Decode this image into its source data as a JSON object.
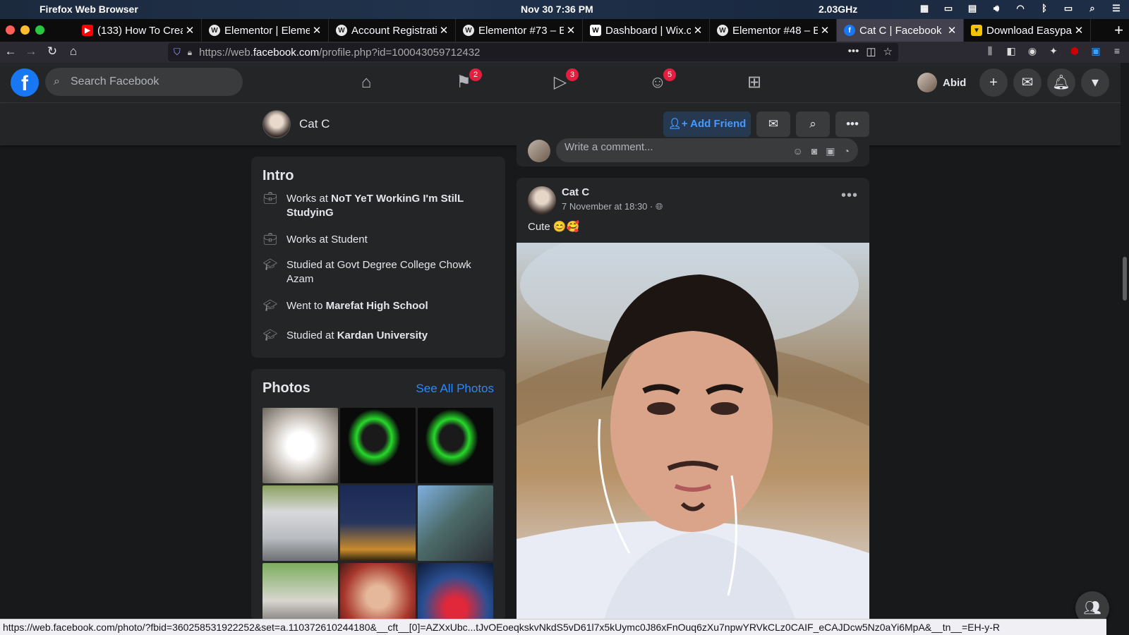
{
  "menubar": {
    "app_name": "Firefox Web Browser",
    "datetime": "Nov 30   7:36 PM",
    "cpu": "2.03GHz"
  },
  "tabs": [
    {
      "label": "(133) How To Crea",
      "icon": "youtube-icon",
      "color": "#ff0000"
    },
    {
      "label": "Elementor | Eleme",
      "icon": "wordpress-icon",
      "color": "#ffffff"
    },
    {
      "label": "Account Registrati",
      "icon": "wordpress-icon",
      "color": "#ffffff"
    },
    {
      "label": "Elementor #73 – E",
      "icon": "wordpress-icon",
      "color": "#ffffff"
    },
    {
      "label": "Dashboard | Wix.c",
      "icon": "wix-icon",
      "color": "#ffffff"
    },
    {
      "label": "Elementor #48 – E",
      "icon": "wordpress-icon",
      "color": "#ffffff"
    },
    {
      "label": "Cat C | Facebook",
      "icon": "facebook-icon",
      "color": "#1877f2",
      "active": true
    },
    {
      "label": "Download Easypa",
      "icon": "download-icon",
      "color": "#f5c400"
    }
  ],
  "address": {
    "url_prefix": "https://web.",
    "url_domain": "facebook.com",
    "url_rest": "/profile.php?id=100043059712432"
  },
  "facebook": {
    "search_placeholder": "Search Facebook",
    "badges": {
      "pages": "2",
      "watch": "3",
      "groups": "5"
    },
    "user_name": "Abid"
  },
  "profile": {
    "name": "Cat C",
    "add_friend_label": "Add Friend"
  },
  "intro": {
    "title": "Intro",
    "items": [
      {
        "prefix": "Works at ",
        "bold": "NoT YeT WorkinG I'm StilL StudyinG",
        "icon": "briefcase-icon"
      },
      {
        "prefix": "Works at Student",
        "bold": "",
        "icon": "briefcase-icon"
      },
      {
        "prefix": "Studied at Govt Degree College Chowk Azam",
        "bold": "",
        "icon": "graduation-cap-icon"
      },
      {
        "prefix": "Went to ",
        "bold": "Marefat High School",
        "icon": "graduation-cap-icon"
      },
      {
        "prefix": "Studied at ",
        "bold": "Kardan University",
        "icon": "graduation-cap-icon"
      }
    ]
  },
  "photos": {
    "title": "Photos",
    "see_all": "See All Photos"
  },
  "post": {
    "comment_placeholder": "Write a comment...",
    "author": "Cat C",
    "timestamp": "7 November at 18:30",
    "text": "Cute 😊🥰"
  },
  "status_bar": {
    "link": "https://web.facebook.com/photo/?fbid=360258531922252&set=a.110372610244180&__cft__[0]=AZXxUbc...tJvOEoeqkskvNkdS5vD61l7x5kUymc0J86xFnOuq6zXu7npwYRVkCLz0CAIF_eCAJDcw5Nz0aYi6MpA&__tn__=EH-y-R"
  }
}
